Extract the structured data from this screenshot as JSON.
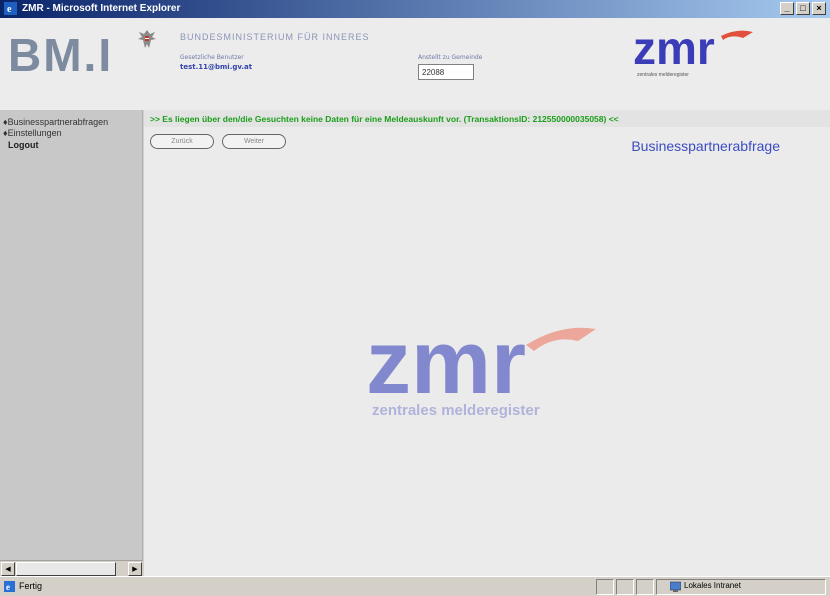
{
  "window": {
    "title": "ZMR - Microsoft Internet Explorer",
    "min": "_",
    "max": "□",
    "close": "×"
  },
  "header": {
    "logo": "BM.I",
    "ministry": "BUNDESMINISTERIUM FÜR INNERES",
    "user_label": "Gesetzliche Benutzer",
    "user_email": "test.11@bmi.gv.at",
    "gemeinde_label": "Anstellt zu Gemeinde",
    "gemeinde_value": "22088",
    "zmr_small_text": "zmr",
    "zmr_small_sub": "zentrales melderegister"
  },
  "nav": {
    "items": [
      {
        "label": "♦Businesspartnerabfragen"
      },
      {
        "label": "♦Einstellungen"
      },
      {
        "label": "Logout"
      }
    ]
  },
  "main": {
    "message": ">> Es liegen über den/die Gesuchten keine Daten für eine Meldeauskunft vor. (TransaktionsID: 212550000035058) <<",
    "btn_back": "Zurück",
    "btn_next": "Weiter",
    "heading": "Businesspartnerabfrage",
    "watermark": "zmr",
    "watermark_sub": "zentrales melderegister"
  },
  "status": {
    "text": "Fertig",
    "zone": "Lokales Intranet"
  },
  "colors": {
    "title_bar": "#0a246a",
    "heading": "#3b4cc0",
    "message": "#1a9e1a",
    "zmr_blue": "#3b3db8",
    "zmr_red": "#e0503c"
  }
}
